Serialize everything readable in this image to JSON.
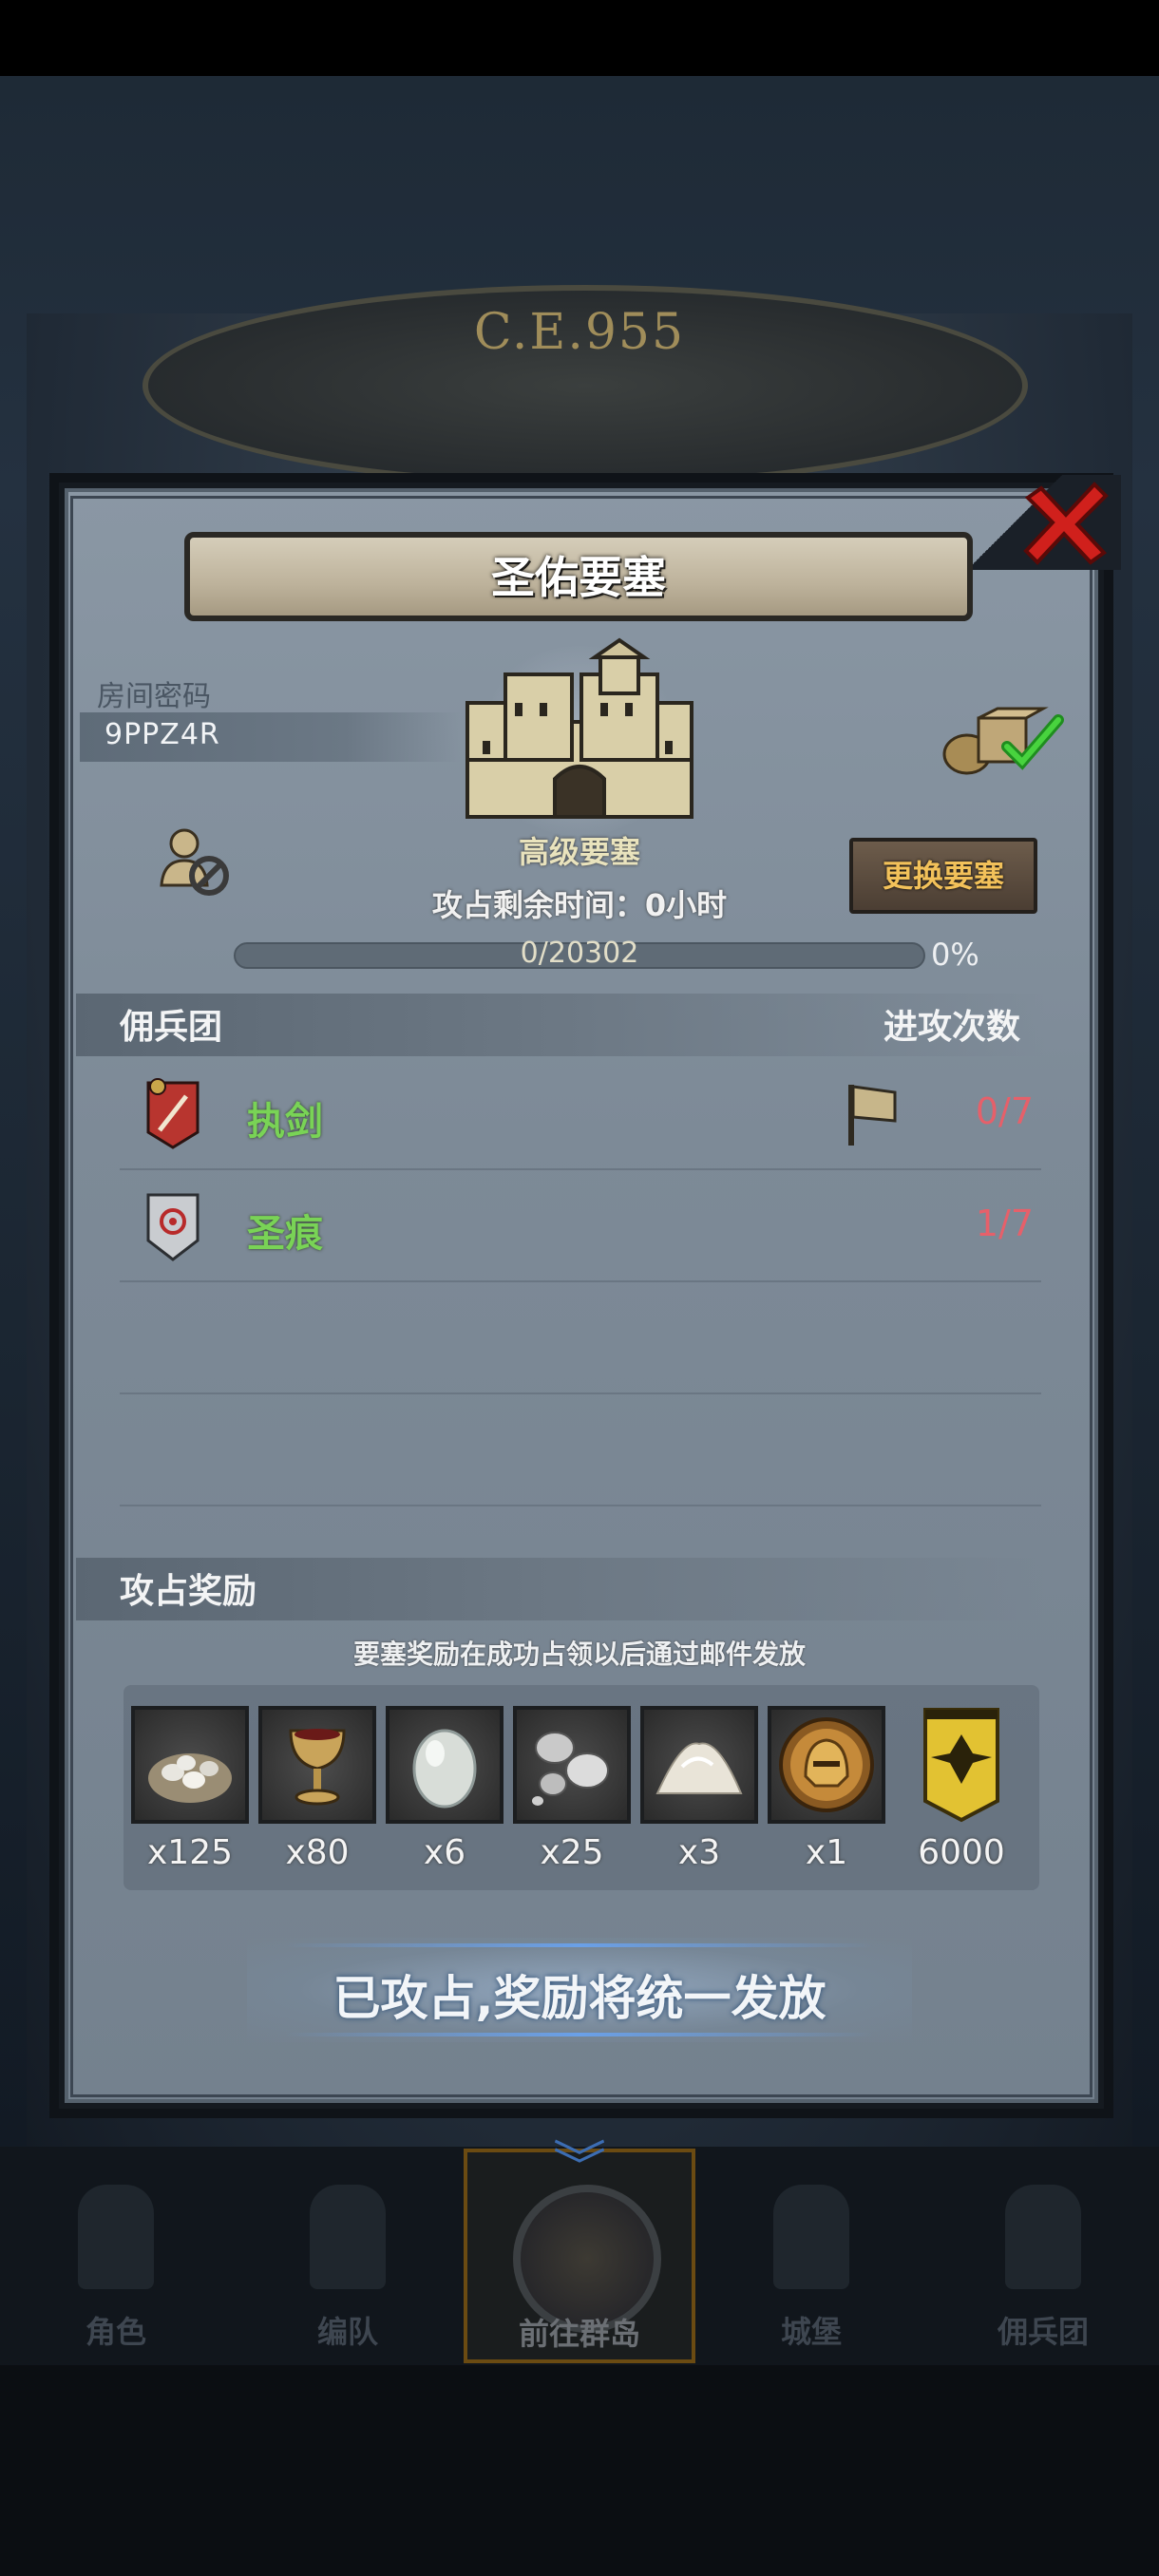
{
  "background": {
    "era_text": "C.E.955"
  },
  "dialog": {
    "title": "圣佑要塞",
    "room_password_label": "房间密码",
    "room_password": "9PPZ4R",
    "fortress_type": "高级要塞",
    "time_remaining": "攻占剩余时间：0小时",
    "change_fortress_button": "更换要塞",
    "progress": {
      "text": "0/20302",
      "percent": "0%",
      "value": 0
    },
    "mercenary_header": "佣兵团",
    "attack_count_header": "进攻次数",
    "mercenaries": [
      {
        "name": "执剑",
        "count": "0/7",
        "emblem_color": "#b8352f",
        "has_flag": true
      },
      {
        "name": "圣痕",
        "count": "1/7",
        "emblem_color": "#c9ccd0",
        "has_flag": false
      }
    ],
    "reward_header": "攻占奖励",
    "reward_note": "要塞奖励在成功占领以后通过邮件发放",
    "rewards": [
      {
        "icon": "silver-ore-pile-icon",
        "qty": "x125"
      },
      {
        "icon": "goblet-icon",
        "qty": "x80"
      },
      {
        "icon": "moonstone-icon",
        "qty": "x6"
      },
      {
        "icon": "silver-pearls-icon",
        "qty": "x25"
      },
      {
        "icon": "salt-pile-icon",
        "qty": "x3"
      },
      {
        "icon": "golden-helmet-icon",
        "qty": "x1"
      },
      {
        "icon": "rank-insignia-icon",
        "qty": "6000"
      }
    ],
    "status_text": "已攻占,奖励将统一发放"
  },
  "nav": {
    "items": [
      {
        "label": "角色"
      },
      {
        "label": "编队"
      },
      {
        "label": "前往群岛"
      },
      {
        "label": "城堡"
      },
      {
        "label": "佣兵团"
      }
    ],
    "active_index": 2
  },
  "colors": {
    "accent_gold": "#f2c15a",
    "merc_name_green": "#79d356",
    "count_red": "#e6606a",
    "status_blue": "#6aa0e8"
  }
}
